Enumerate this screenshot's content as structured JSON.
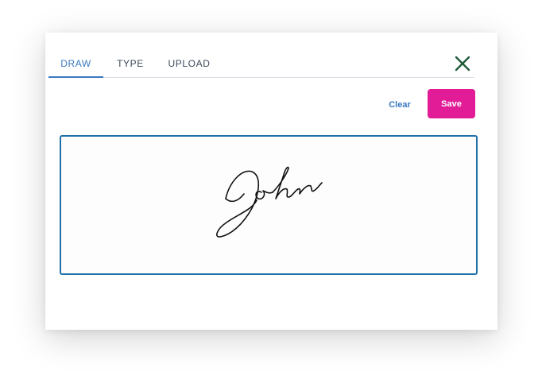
{
  "tabs": [
    {
      "label": "DRAW",
      "active": true
    },
    {
      "label": "TYPE",
      "active": false
    },
    {
      "label": "UPLOAD",
      "active": false
    }
  ],
  "actions": {
    "clear_label": "Clear",
    "save_label": "Save"
  },
  "signature": {
    "text": "John"
  },
  "colors": {
    "accent": "#3a79c0",
    "save_button": "#e21b97",
    "close_icon": "#1f5a3a",
    "canvas_border": "#1f6fa8"
  },
  "icons": {
    "close": "close-icon"
  }
}
